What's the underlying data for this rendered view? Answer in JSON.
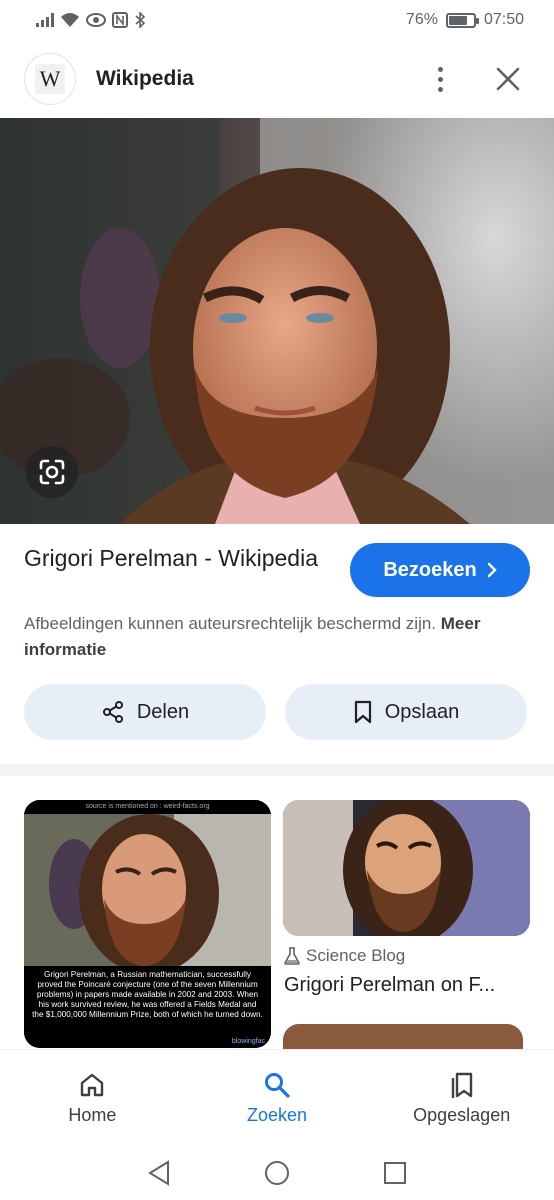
{
  "status_bar": {
    "battery": "76%",
    "time": "07:50",
    "battery_level": 0.76
  },
  "header": {
    "logo_letter": "W",
    "site_name": "Wikipedia"
  },
  "result": {
    "title": "Grigori Perelman - Wikipedia",
    "visit_label": "Bezoeken",
    "copyright_text": "Afbeeldingen kunnen auteursrechtelijk beschermd zijn.",
    "more_info": "Meer informatie",
    "share_label": "Delen",
    "save_label": "Opslaan"
  },
  "related": {
    "left_card": {
      "source_note": "source is mentioned on : weird-facts.org",
      "caption": "Grigori Perelman, a Russian mathematician, successfully proved the Poincaré conjecture (one of the seven Millennium problems) in papers made available in 2002 and 2003. When his work survived review, he was offered a Fields Medal and the $1,000,000 Millennium Prize, both of which he turned down.",
      "tag": "blowingfac"
    },
    "right_card": {
      "source": "Science Blog",
      "title": "Grigori Perelman on F..."
    }
  },
  "bottom_nav": {
    "items": [
      {
        "label": "Home",
        "icon": "home-icon"
      },
      {
        "label": "Zoeken",
        "icon": "search-icon"
      },
      {
        "label": "Opgeslagen",
        "icon": "collections-icon"
      }
    ],
    "active": "Zoeken"
  },
  "colors": {
    "accent": "#1a73e8",
    "pill_bg": "#e8eef8",
    "text_secondary": "#5f6368"
  }
}
